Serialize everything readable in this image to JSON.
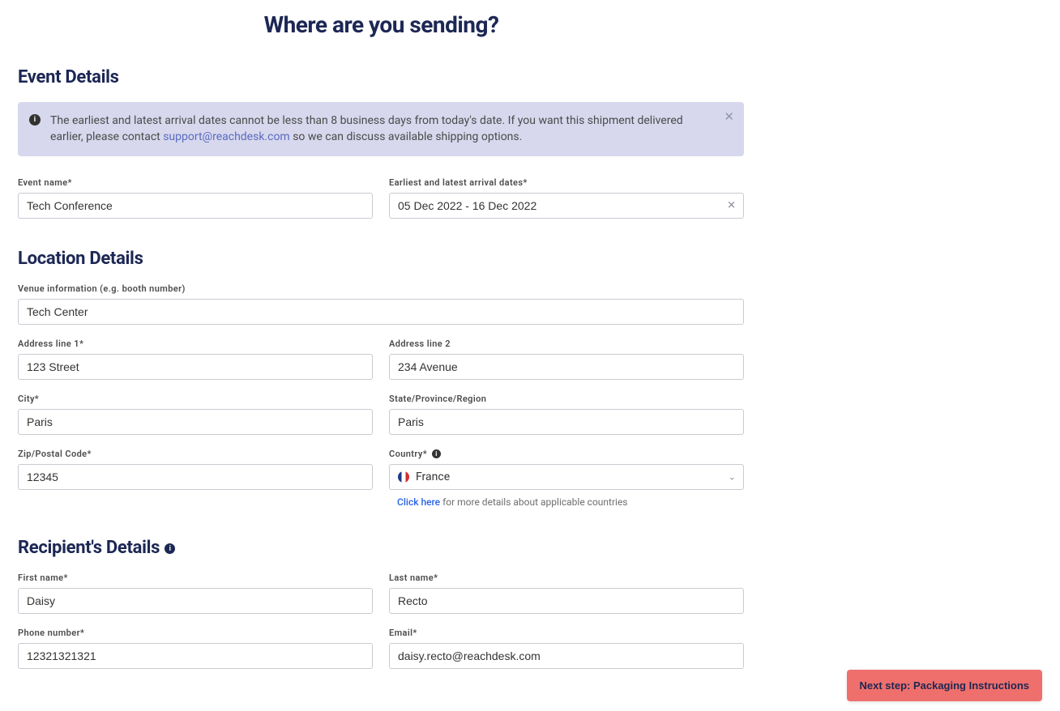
{
  "page_title": "Where are you sending?",
  "sections": {
    "event": {
      "title": "Event Details",
      "info_banner": {
        "text_before": "The earliest and latest arrival dates cannot be less than 8 business days from today's date. If you want this shipment delivered earlier, please contact ",
        "link_text": "support@reachdesk.com",
        "text_after": " so we can discuss available shipping options."
      },
      "event_name_label": "Event name*",
      "event_name_value": "Tech Conference",
      "arrival_dates_label": "Earliest and latest arrival dates*",
      "arrival_dates_value": "05 Dec 2022 - 16 Dec 2022"
    },
    "location": {
      "title": "Location Details",
      "venue_label": "Venue information (e.g. booth number)",
      "venue_value": "Tech Center",
      "address1_label": "Address line 1*",
      "address1_value": "123 Street",
      "address2_label": "Address line 2",
      "address2_value": "234 Avenue",
      "city_label": "City*",
      "city_value": "Paris",
      "state_label": "State/Province/Region",
      "state_value": "Paris",
      "zip_label": "Zip/Postal Code*",
      "zip_value": "12345",
      "country_label": "Country*",
      "country_value": "France",
      "country_helper_link": "Click here",
      "country_helper_text": " for more details about applicable countries"
    },
    "recipient": {
      "title": "Recipient's Details",
      "first_name_label": "First name*",
      "first_name_value": "Daisy",
      "last_name_label": "Last name*",
      "last_name_value": "Recto",
      "phone_label": "Phone number*",
      "phone_value": "12321321321",
      "email_label": "Email*",
      "email_value": "daisy.recto@reachdesk.com"
    }
  },
  "next_button": "Next step: Packaging Instructions"
}
